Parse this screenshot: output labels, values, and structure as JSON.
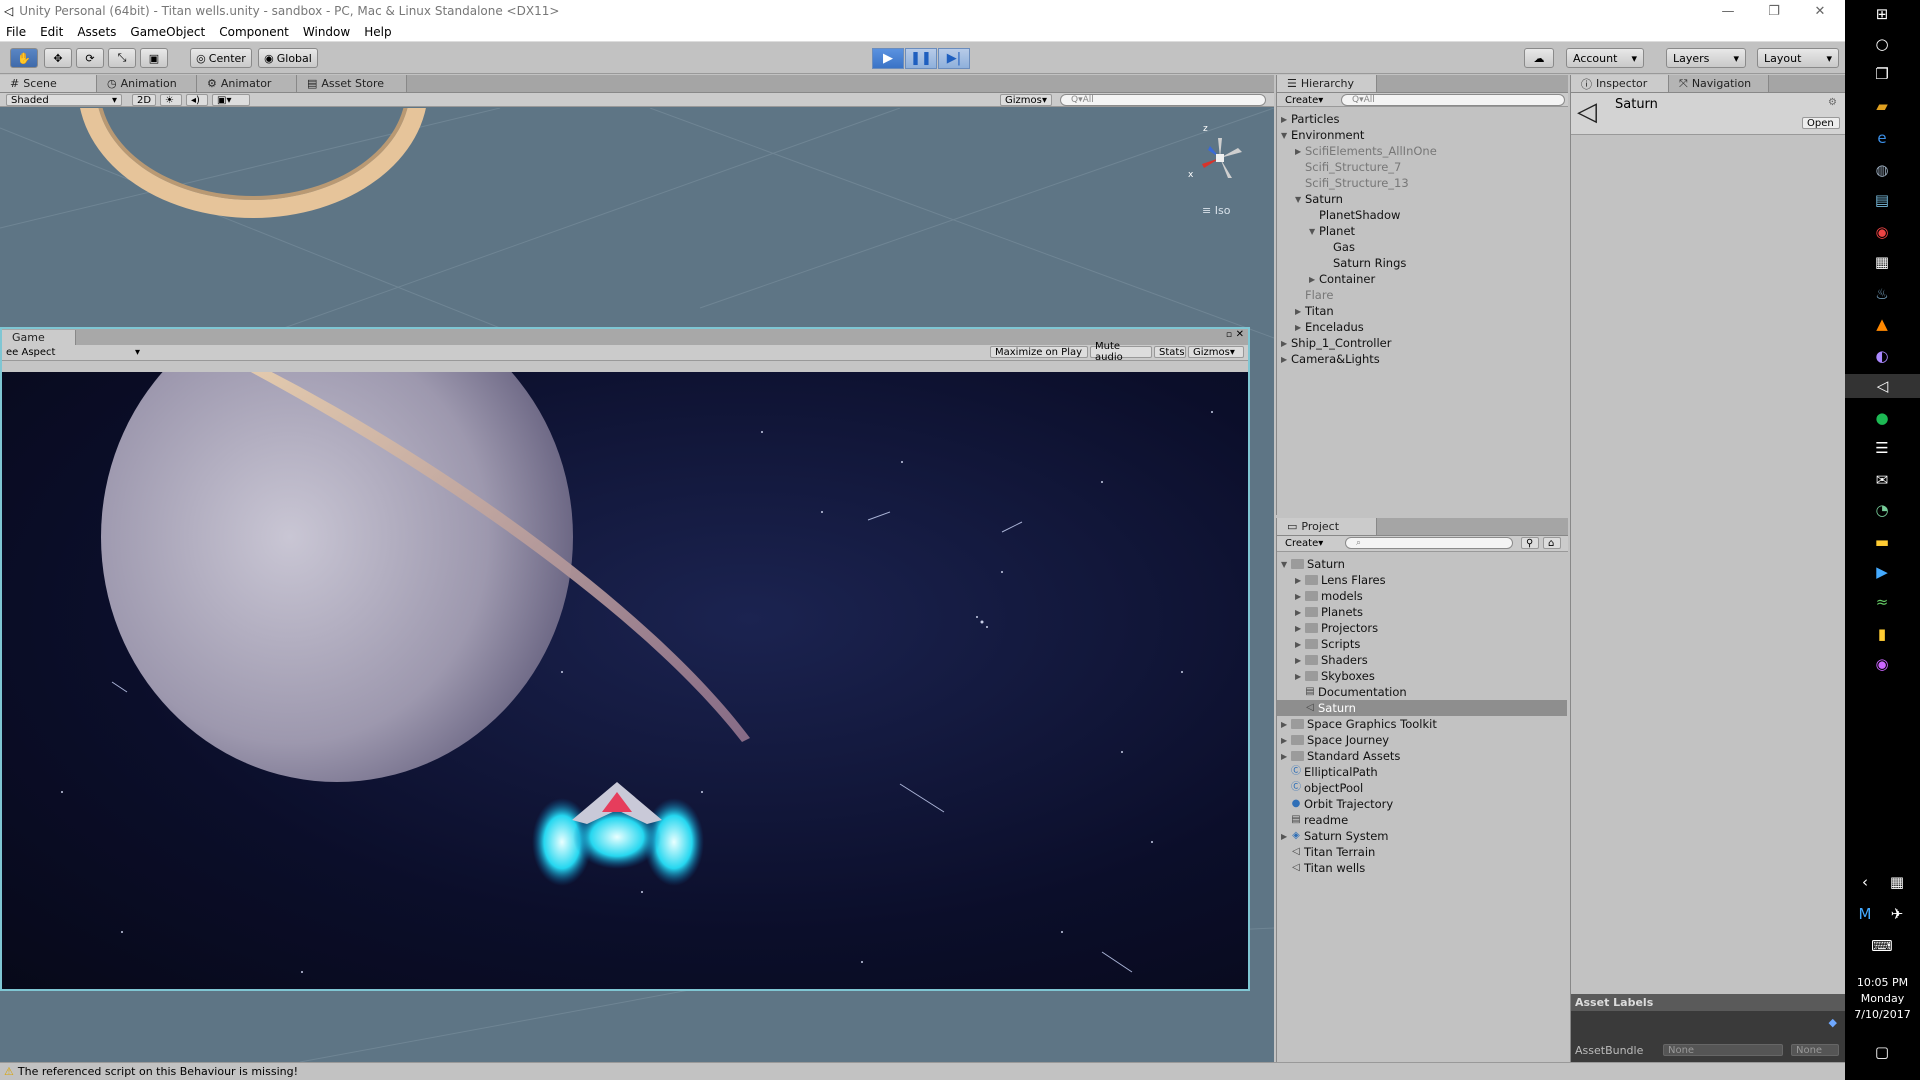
{
  "window": {
    "title": "Unity Personal (64bit) - Titan wells.unity - sandbox - PC, Mac & Linux Standalone <DX11>",
    "controls": {
      "minimize": "—",
      "restore": "❐",
      "close": "✕"
    }
  },
  "menu": [
    "File",
    "Edit",
    "Assets",
    "GameObject",
    "Component",
    "Window",
    "Help"
  ],
  "toolbar": {
    "pivot": "Center",
    "space": "Global",
    "account": "Account",
    "layers": "Layers",
    "layout": "Layout"
  },
  "scene_panel": {
    "tabs": [
      "Scene",
      "Animation",
      "Animator",
      "Asset Store"
    ],
    "shading": "Shaded",
    "mode_2d": "2D",
    "gizmos": "Gizmos",
    "search_placeholder": "Q▾All",
    "iso_label": "Iso",
    "gizmo_axes": {
      "x": "x",
      "z": "z"
    }
  },
  "game_panel": {
    "tab": "Game",
    "aspect": "ee Aspect",
    "buttons": [
      "Maximize on Play",
      "Mute audio",
      "Stats",
      "Gizmos"
    ]
  },
  "hierarchy": {
    "tab": "Hierarchy",
    "create": "Create",
    "search_placeholder": "Q▾All",
    "items": [
      {
        "label": "Particles",
        "depth": 0,
        "arrow": "▶",
        "dim": false
      },
      {
        "label": "Environment",
        "depth": 0,
        "arrow": "▼",
        "dim": false
      },
      {
        "label": "ScifiElements_AllInOne",
        "depth": 1,
        "arrow": "▶",
        "dim": true
      },
      {
        "label": "Scifi_Structure_7",
        "depth": 1,
        "arrow": "",
        "dim": true
      },
      {
        "label": "Scifi_Structure_13",
        "depth": 1,
        "arrow": "",
        "dim": true
      },
      {
        "label": "Saturn",
        "depth": 1,
        "arrow": "▼",
        "dim": false
      },
      {
        "label": "PlanetShadow",
        "depth": 2,
        "arrow": "",
        "dim": false
      },
      {
        "label": "Planet",
        "depth": 2,
        "arrow": "▼",
        "dim": false
      },
      {
        "label": "Gas",
        "depth": 3,
        "arrow": "",
        "dim": false
      },
      {
        "label": "Saturn Rings",
        "depth": 3,
        "arrow": "",
        "dim": false
      },
      {
        "label": "Container",
        "depth": 2,
        "arrow": "▶",
        "dim": false
      },
      {
        "label": "Flare",
        "depth": 1,
        "arrow": "",
        "dim": true
      },
      {
        "label": "Titan",
        "depth": 1,
        "arrow": "▶",
        "dim": false
      },
      {
        "label": "Enceladus",
        "depth": 1,
        "arrow": "▶",
        "dim": false
      },
      {
        "label": "Ship_1_Controller",
        "depth": 0,
        "arrow": "▶",
        "dim": false
      },
      {
        "label": "Camera&Lights",
        "depth": 0,
        "arrow": "▶",
        "dim": false
      }
    ]
  },
  "project": {
    "tab": "Project",
    "create": "Create",
    "items": [
      {
        "label": "Saturn",
        "depth": 0,
        "arrow": "▼",
        "icon": "folder",
        "selected": false
      },
      {
        "label": "Lens Flares",
        "depth": 1,
        "arrow": "▶",
        "icon": "folder",
        "selected": false
      },
      {
        "label": "models",
        "depth": 1,
        "arrow": "▶",
        "icon": "folder",
        "selected": false
      },
      {
        "label": "Planets",
        "depth": 1,
        "arrow": "▶",
        "icon": "folder",
        "selected": false
      },
      {
        "label": "Projectors",
        "depth": 1,
        "arrow": "▶",
        "icon": "folder",
        "selected": false
      },
      {
        "label": "Scripts",
        "depth": 1,
        "arrow": "▶",
        "icon": "folder",
        "selected": false
      },
      {
        "label": "Shaders",
        "depth": 1,
        "arrow": "▶",
        "icon": "folder",
        "selected": false
      },
      {
        "label": "Skyboxes",
        "depth": 1,
        "arrow": "▶",
        "icon": "folder",
        "selected": false
      },
      {
        "label": "Documentation",
        "depth": 1,
        "arrow": "",
        "icon": "doc",
        "selected": false
      },
      {
        "label": "Saturn",
        "depth": 1,
        "arrow": "",
        "icon": "unity",
        "selected": true
      },
      {
        "label": "Space Graphics Toolkit",
        "depth": 0,
        "arrow": "▶",
        "icon": "folder",
        "selected": false
      },
      {
        "label": "Space Journey",
        "depth": 0,
        "arrow": "▶",
        "icon": "folder",
        "selected": false
      },
      {
        "label": "Standard Assets",
        "depth": 0,
        "arrow": "▶",
        "icon": "folder",
        "selected": false
      },
      {
        "label": "EllipticalPath",
        "depth": 0,
        "arrow": "",
        "icon": "script",
        "selected": false
      },
      {
        "label": "objectPool",
        "depth": 0,
        "arrow": "",
        "icon": "script",
        "selected": false
      },
      {
        "label": "Orbit Trajectory",
        "depth": 0,
        "arrow": "",
        "icon": "sphere",
        "selected": false
      },
      {
        "label": "readme",
        "depth": 0,
        "arrow": "",
        "icon": "doc",
        "selected": false
      },
      {
        "label": "Saturn System",
        "depth": 0,
        "arrow": "▶",
        "icon": "prefab",
        "selected": false
      },
      {
        "label": "Titan Terrain",
        "depth": 0,
        "arrow": "",
        "icon": "unity",
        "selected": false
      },
      {
        "label": "Titan wells",
        "depth": 0,
        "arrow": "",
        "icon": "unity",
        "selected": false
      }
    ]
  },
  "inspector": {
    "tabs": [
      "Inspector",
      "Navigation"
    ],
    "object_name": "Saturn",
    "open_button": "Open",
    "asset_labels": "Asset Labels",
    "asset_bundle_label": "AssetBundle",
    "asset_bundle_value": "None",
    "asset_variant_value": "None"
  },
  "status": {
    "message": "The referenced script on this Behaviour is missing!"
  },
  "taskbar": {
    "time": "10:05 PM",
    "day": "Monday",
    "date": "7/10/2017"
  },
  "colors": {
    "scene_bg": "#5e7585",
    "game_bg": "#0c1030",
    "accent": "#3f6aaa"
  }
}
